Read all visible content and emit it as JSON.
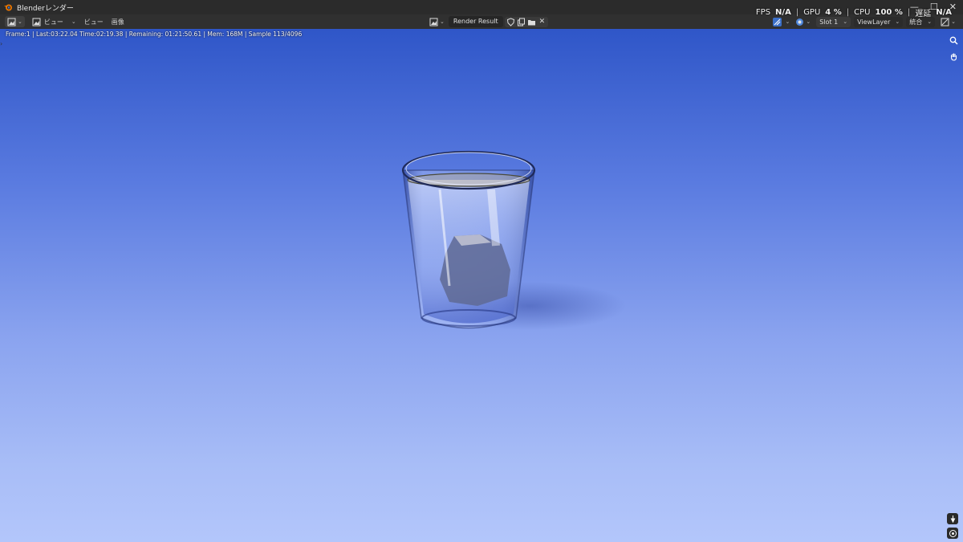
{
  "window": {
    "title": "Blenderレンダー",
    "controls": [
      "minimize",
      "maximize",
      "close"
    ]
  },
  "header": {
    "view_menu_label": "ビュー",
    "menus": [
      "ビュー",
      "画像"
    ],
    "image_name": "Render Result",
    "slot": "Slot 1",
    "view_layer": "ViewLayer",
    "pass": "統合"
  },
  "perf": {
    "fps_label": "FPS",
    "fps_value": "N/A",
    "gpu_label": "GPU",
    "gpu_value": "4 %",
    "cpu_label": "CPU",
    "cpu_value": "100 %",
    "latency_label": "遅延",
    "latency_value": "N/A"
  },
  "render": {
    "status": "Frame:1 | Last:03:22.04 Time:02:19.38 | Remaining: 01:21:50.61 | Mem: 168M | Sample 113/4096"
  },
  "colors": {
    "bg_top": "#2f56c8",
    "bg_bottom": "#b3c6fb"
  }
}
